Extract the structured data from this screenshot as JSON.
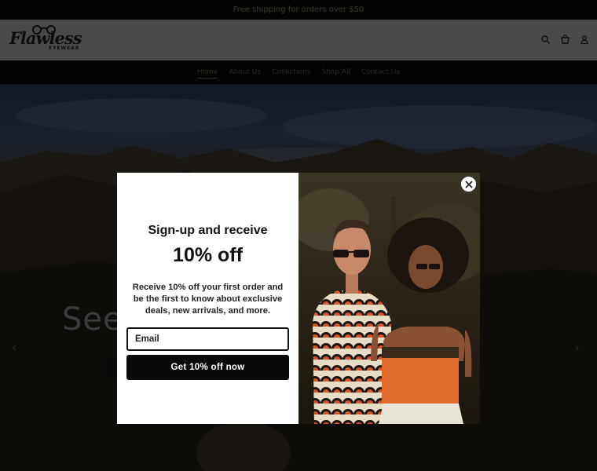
{
  "announcement": {
    "text": "Free shipping for orders over $50"
  },
  "brand": {
    "logo_name": "Flawless",
    "logo_sub": "EYEWEAR"
  },
  "header_icons": [
    "search-icon",
    "cart-icon",
    "account-icon"
  ],
  "nav": {
    "items": [
      {
        "label": "Home",
        "active": true
      },
      {
        "label": "About Us",
        "active": false
      },
      {
        "label": "Collections",
        "active": false
      },
      {
        "label": "Shop All",
        "active": false
      },
      {
        "label": "Contact Us",
        "active": false
      }
    ]
  },
  "hero": {
    "title": "See",
    "prev_icon": "chevron-left-icon",
    "next_icon": "chevron-right-icon"
  },
  "popup": {
    "heading": "Sign-up and receive",
    "offer": "10% off",
    "body": "Receive 10% off your first order and be the first to know about exclusive deals, new arrivals, and more.",
    "email_placeholder": "Email",
    "cta_label": "Get 10% off now",
    "close_icon": "close-icon"
  }
}
